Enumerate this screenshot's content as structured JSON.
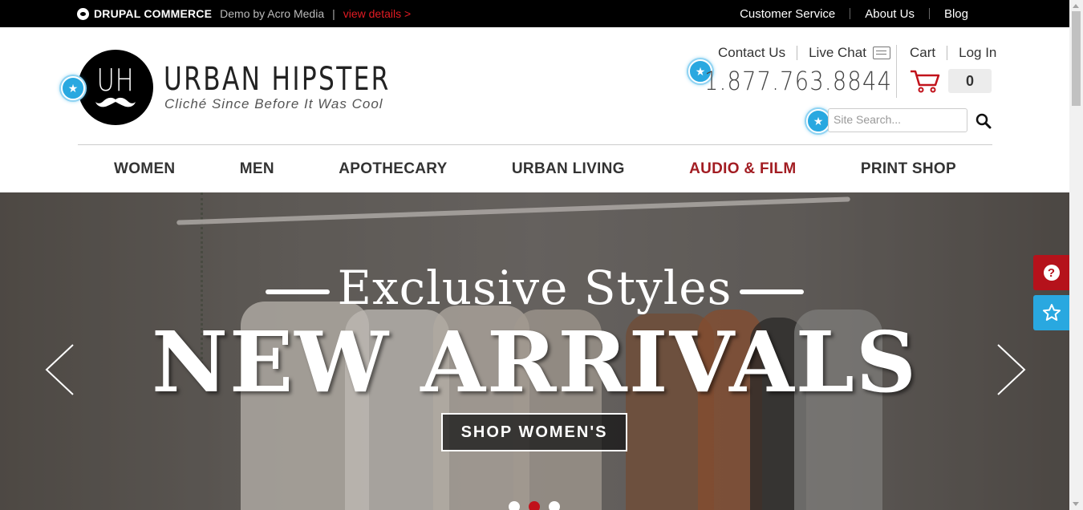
{
  "topbar": {
    "brand_strong": "DRUPAL COMMERCE",
    "brand_demo": "Demo by Acro Media",
    "brand_sep": "|",
    "details_link": "view details >",
    "links": [
      "Customer Service",
      "About Us",
      "Blog"
    ]
  },
  "header": {
    "logo_initials": "UH",
    "logo_title": "URBAN HIPSTER",
    "logo_tagline": "Cliché Since Before It Was Cool",
    "contact_label": "Contact Us",
    "live_chat_label": "Live Chat",
    "phone": "1.877.763.8844",
    "cart_label": "Cart",
    "login_label": "Log In",
    "cart_count": "0",
    "search_placeholder": "Site Search..."
  },
  "nav": {
    "items": [
      "WOMEN",
      "MEN",
      "APOTHECARY",
      "URBAN LIVING",
      "AUDIO & FILM",
      "PRINT SHOP"
    ],
    "active_item": "AUDIO & FILM"
  },
  "hero": {
    "subtitle": "Exclusive Styles",
    "title": "NEW ARRIVALS",
    "cta_label": "SHOP WOMEN'S",
    "slide_count": 3,
    "active_slide": 2
  },
  "side_tabs": {
    "help_symbol": "?"
  },
  "colors": {
    "accent_red": "#c1121b",
    "nav_active": "#a21c22",
    "details_link": "#e21b23",
    "badge_blue": "#29a8e0"
  },
  "icons": [
    "drupal-drop-icon",
    "chat-bubble-icon",
    "cart-icon",
    "search-icon",
    "chevron-left-icon",
    "chevron-right-icon",
    "help-icon",
    "star-icon"
  ]
}
